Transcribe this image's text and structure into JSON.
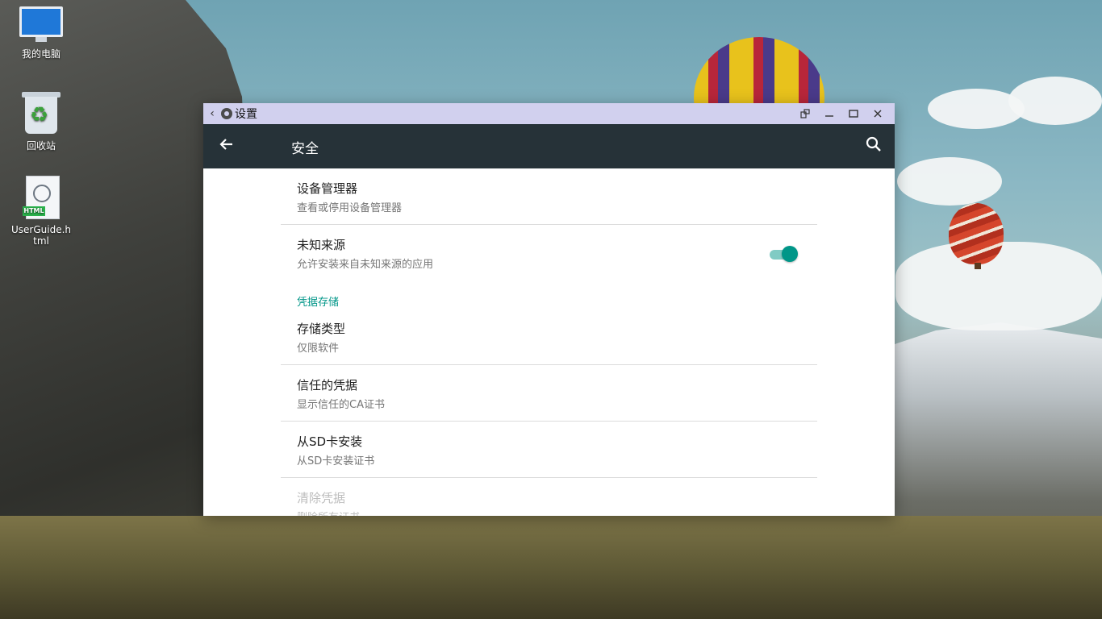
{
  "desktop": {
    "icons": [
      {
        "label": "我的电脑"
      },
      {
        "label": "回收站"
      },
      {
        "label": "UserGuide.h\ntml",
        "badge": "HTML"
      }
    ]
  },
  "window": {
    "title": "设置",
    "icons": [
      "back-chevron-icon",
      "gear-icon",
      "rotate-icon",
      "minimize-icon",
      "maximize-icon",
      "close-icon"
    ]
  },
  "appbar": {
    "title": "安全",
    "icons": [
      "back-arrow-icon",
      "search-icon"
    ]
  },
  "settings": {
    "items": [
      {
        "title": "设备管理器",
        "summary": "查看或停用设备管理器"
      },
      {
        "title": "未知来源",
        "summary": "允许安装来自未知来源的应用",
        "toggle_on": true
      }
    ],
    "section_header": "凭据存储",
    "storage_items": [
      {
        "title": "存储类型",
        "summary": "仅限软件"
      },
      {
        "title": "信任的凭据",
        "summary": "显示信任的CA证书"
      },
      {
        "title": "从SD卡安装",
        "summary": "从SD卡安装证书"
      },
      {
        "title": "清除凭据",
        "summary": "删除所有证书",
        "disabled": true
      }
    ]
  },
  "colors": {
    "appbar": "#263238",
    "titlebar": "#d1d0ee",
    "accent": "#009688",
    "toggle_track": "#80cbc4"
  }
}
